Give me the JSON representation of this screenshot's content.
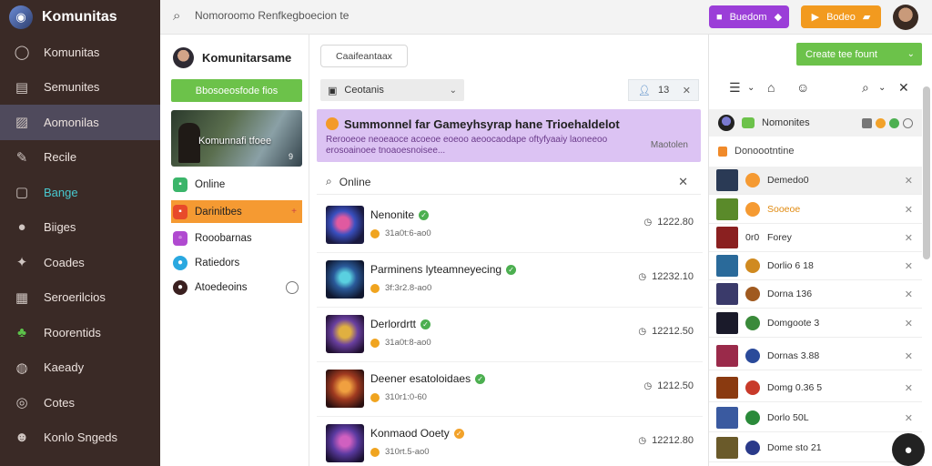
{
  "app": {
    "title": "Komunitas"
  },
  "nav": {
    "items": [
      {
        "label": "Komunitas",
        "icon": "circle-icon"
      },
      {
        "label": "Semunites",
        "icon": "list-icon"
      },
      {
        "label": "Aomonilas",
        "icon": "image-icon"
      },
      {
        "label": "Recile",
        "icon": "pencil-icon"
      },
      {
        "label": "Bange",
        "icon": "square-icon"
      },
      {
        "label": "Biiges",
        "icon": "user-icon"
      },
      {
        "label": "Coades",
        "icon": "puzzle-icon"
      },
      {
        "label": "Seroerilcios",
        "icon": "grid-icon"
      },
      {
        "label": "Roorentids",
        "icon": "clover-icon"
      },
      {
        "label": "Kaeady",
        "icon": "gamepad-icon"
      },
      {
        "label": "Cotes",
        "icon": "settings-icon"
      },
      {
        "label": "Konlo Sngeds",
        "icon": "avatar-icon"
      }
    ]
  },
  "topbar": {
    "search_text": "Nomoroomo Renfkegboecion te",
    "purple_button": "Buedom",
    "orange_button": "Bodeo"
  },
  "col2": {
    "username": "Komunitarsame",
    "green_button": "Bbosoeosfode fios",
    "banner_title": "Komunnafi tfoee",
    "banner_count": "9",
    "items": [
      {
        "label": "Online",
        "color": "#3bb56a"
      },
      {
        "label": "Darinitbes",
        "color": "#e84a2a",
        "end": "+"
      },
      {
        "label": "Rooobarnas",
        "color": "#b04ad0"
      },
      {
        "label": "Ratiedors",
        "color": "#2aa8e0"
      },
      {
        "label": "Atoedeoins",
        "color": "#3a2020"
      }
    ]
  },
  "main": {
    "filter_label": "Caaifeantaax",
    "select_label": "Ceotanis",
    "counter_label": "13",
    "promo": {
      "title": "Summonnel far Gameyhsyrap hane Trioehaldelot",
      "desc": "Rerooeoe neoeaoce acoeoe eoeoo aeoocaodape oftyfyaaiy laoneeoo erosoainoee tnoaoesnoisee...",
      "action": "Maotolen"
    },
    "search_text": "Online",
    "rows": [
      {
        "name": "Nenonite",
        "badge": "green",
        "sub": "31a0t:6-ao0",
        "time": "1222.80"
      },
      {
        "name": "Parminens lyteamneyecing",
        "badge": "green",
        "sub": "3f:3r2.8-ao0",
        "time": "12232.10"
      },
      {
        "name": "Derlordrtt",
        "badge": "green",
        "sub": "31a0t:8-ao0",
        "time": "12212.50"
      },
      {
        "name": "Deener esatoloidaes",
        "badge": "green",
        "sub": "310r1:0-60",
        "time": "1212.50"
      },
      {
        "name": "Konmaod Ooety",
        "badge": "orange",
        "sub": "310rt.5-ao0",
        "time": "12212.80"
      }
    ]
  },
  "right": {
    "create_button": "Create tee fount",
    "head_label": "Nomonites",
    "sub_label": "Donoootntine",
    "items": [
      {
        "label": "Demedo0",
        "orange": false,
        "ci": "#f59a32",
        "th": "#2a3a55"
      },
      {
        "label": "Sooeoe",
        "orange": true,
        "ci": "#f59a32",
        "th": "#5a8a2a"
      },
      {
        "label": "Forey",
        "orange": false,
        "ci": "",
        "th": "#8a2020",
        "prefix": "0r0"
      },
      {
        "label": "Dorlio 6 18",
        "orange": false,
        "ci": "#d08a20",
        "th": "#2a6a9a"
      },
      {
        "label": "Dorna 136",
        "orange": false,
        "ci": "#a05a20",
        "th": "#3a3a6a"
      },
      {
        "label": "Domgoote 3",
        "orange": false,
        "ci": "#3a8a3a",
        "th": "#1a1a2a"
      },
      {
        "label": "Dornas 3.88",
        "orange": false,
        "ci": "#2a4a9a",
        "th": "#9a2a4a"
      },
      {
        "label": "Domg 0.36 5",
        "orange": false,
        "ci": "#c83a2a",
        "th": "#8a3a10"
      },
      {
        "label": "Dorlo 50L",
        "orange": false,
        "ci": "#2a8a3a",
        "th": "#3a5aa0"
      },
      {
        "label": "Dome sto 21",
        "orange": false,
        "ci": "#2a3a8a",
        "th": "#6a5a2a"
      }
    ]
  }
}
